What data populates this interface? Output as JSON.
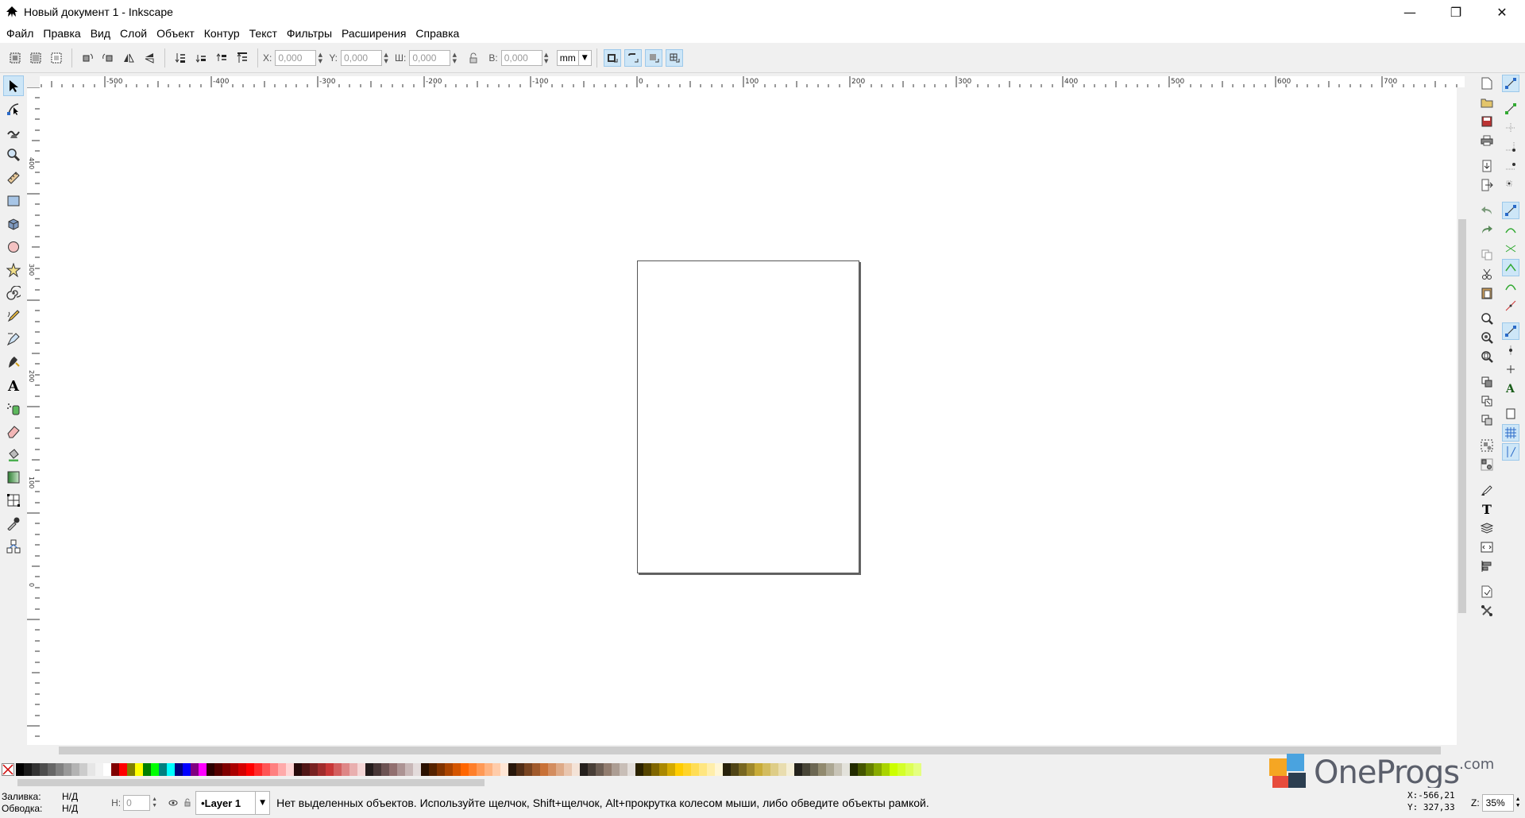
{
  "window": {
    "title": "Новый документ 1 - Inkscape",
    "minimize": "—",
    "maximize": "❐",
    "close": "✕"
  },
  "menu": [
    "Файл",
    "Правка",
    "Вид",
    "Слой",
    "Объект",
    "Контур",
    "Текст",
    "Фильтры",
    "Расширения",
    "Справка"
  ],
  "controls": {
    "x_label": "X:",
    "x_value": "0,000",
    "y_label": "Y:",
    "y_value": "0,000",
    "w_label": "Ш:",
    "w_value": "0,000",
    "h_label": "В:",
    "h_value": "0,000",
    "unit": "mm"
  },
  "ruler": {
    "h_labels": [
      "-500",
      "-400",
      "-300",
      "-200",
      "-100",
      "0",
      "100",
      "200",
      "300",
      "400",
      "500",
      "600",
      "700"
    ],
    "v_labels": [
      "400",
      "300",
      "200",
      "100",
      "0"
    ]
  },
  "status": {
    "fill_label": "Заливка:",
    "fill_value": "Н/Д",
    "stroke_label": "Обводка:",
    "stroke_value": "Н/Д",
    "h_label": "Н:",
    "h_value": "0",
    "layer": "•Layer 1",
    "message": "Нет выделенных объектов. Используйте щелчок, Shift+щелчок, Alt+прокрутка колесом мыши, либо обведите объекты рамкой.",
    "x_coord": "X:-566,21",
    "y_coord": "Y: 327,33",
    "zoom_label": "Z:",
    "zoom_value": "35%"
  },
  "watermark": {
    "brand": "OneProgs",
    "tld": ".com"
  },
  "colors": {
    "accent": "#cde6f7",
    "accent_border": "#9cc8ea"
  },
  "palette": [
    "#000000",
    "#1a1a1a",
    "#333333",
    "#4d4d4d",
    "#666666",
    "#808080",
    "#999999",
    "#b3b3b3",
    "#cccccc",
    "#e6e6e6",
    "#f2f2f2",
    "#ffffff",
    "#800000",
    "#ff0000",
    "#808000",
    "#ffff00",
    "#008000",
    "#00ff00",
    "#008080",
    "#00ffff",
    "#000080",
    "#0000ff",
    "#800080",
    "#ff00ff",
    "#2b0000",
    "#550000",
    "#800000",
    "#aa0000",
    "#d40000",
    "#ff0000",
    "#ff2a2a",
    "#ff5555",
    "#ff8080",
    "#ffaaaa",
    "#ffd5d5",
    "#280b0b",
    "#501616",
    "#782121",
    "#a02c2c",
    "#c83737",
    "#d35f5f",
    "#de8787",
    "#e9afaf",
    "#f4d7d7",
    "#241c1c",
    "#483737",
    "#6c5353",
    "#916f6f",
    "#ac9393",
    "#c8b7b7",
    "#e3dbdb",
    "#2b1100",
    "#552200",
    "#803300",
    "#aa4400",
    "#d45500",
    "#ff6600",
    "#ff7f2a",
    "#ff9955",
    "#ffb380",
    "#ffccaa",
    "#ffe6d5",
    "#28170b",
    "#502d16",
    "#784421",
    "#a05a2c",
    "#c87137",
    "#d38d5f",
    "#deaa87",
    "#e9c6af",
    "#f4e3d7",
    "#241f1c",
    "#483e37",
    "#6c5d53",
    "#917c6f",
    "#ac9d93",
    "#c8beb7",
    "#e3dedb",
    "#2b2200",
    "#554400",
    "#806600",
    "#aa8800",
    "#d4aa00",
    "#ffcc00",
    "#ffd42a",
    "#ffdd55",
    "#ffe680",
    "#ffeeaa",
    "#fff6d5",
    "#28220b",
    "#504416",
    "#786721",
    "#a0892c",
    "#c8ab37",
    "#d3bc5f",
    "#decd87",
    "#e9ddaf",
    "#f4eed7",
    "#24221c",
    "#484537",
    "#6c6753",
    "#918a6f",
    "#aca793",
    "#c8c4b7",
    "#e3e2db",
    "#222b00",
    "#445500",
    "#668000",
    "#88aa00",
    "#aad400",
    "#ccff00",
    "#d4ff2a",
    "#ddff55",
    "#e5ff80"
  ]
}
